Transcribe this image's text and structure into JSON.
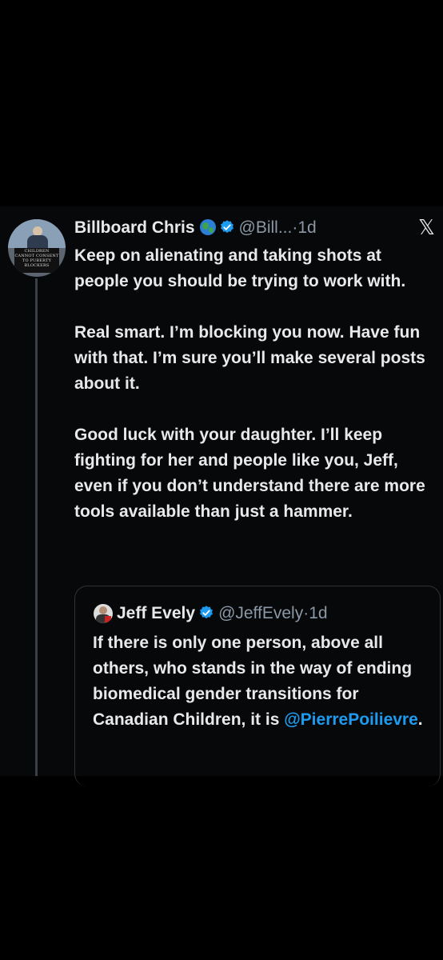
{
  "tweet": {
    "author_name": "Billboard Chris",
    "author_handle": "@Bill...",
    "separator": "·",
    "time": "1d",
    "avatar_sign_text": "CHILDREN CANNOT CONSENT TO PUBERTY BLOCKERS",
    "paragraphs": [
      "Keep on alienating and taking shots at people you should be trying to work with.",
      "Real smart. I’m blocking you now. Have fun with that. I’m sure you’ll make several posts about it.",
      "Good luck with your daughter. I’ll keep fighting for her and people like you, Jeff, even if you don’t understand there are more tools available than just a hammer."
    ]
  },
  "quote": {
    "author_name": "Jeff Evely",
    "author_handle": "@JeffEvely",
    "separator": "·",
    "time": "1d",
    "text_before_mention": "If there is only one person, above all others, who stands in the way of ending biomedical gender transitions for Canadian Children, it is ",
    "mention": "@PierrePoilievre",
    "text_after_mention": "."
  },
  "icons": {
    "globe": "globe-icon",
    "verified": "verified-badge-icon",
    "brand": "x-logo-icon"
  },
  "colors": {
    "background": "#000000",
    "text": "#e7e9ea",
    "secondary_text": "#8b98a5",
    "link": "#1d9bf0",
    "verified": "#1d9bf0"
  }
}
